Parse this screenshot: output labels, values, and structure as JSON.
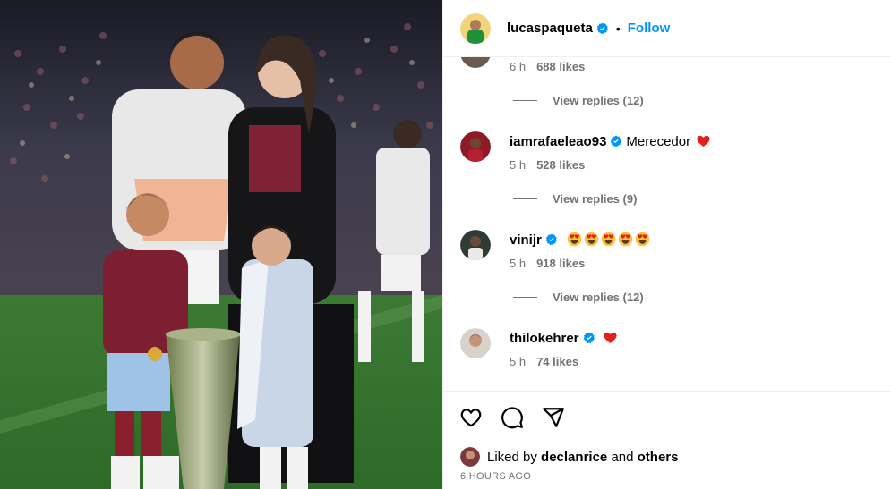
{
  "post": {
    "image_alt": "Footballer in white shirt with woman and two children beside a trophy on a stadium pitch",
    "author": {
      "username": "lucaspaqueta",
      "verified": true
    },
    "follow_label": "Follow",
    "separator": "•"
  },
  "comments": [
    {
      "username": "",
      "text": "",
      "time": "6 h",
      "likes": "688 likes",
      "replies_label": "View replies (12)",
      "partial": true
    },
    {
      "username": "iamrafaeleao93",
      "verified": true,
      "text": "Merecedor",
      "emoji": [
        "red-heart"
      ],
      "time": "5 h",
      "likes": "528 likes",
      "replies_label": "View replies (9)"
    },
    {
      "username": "vinijr",
      "verified": true,
      "text": "",
      "emoji": [
        "heart-eyes",
        "heart-eyes",
        "heart-eyes",
        "heart-eyes",
        "heart-eyes"
      ],
      "time": "5 h",
      "likes": "918 likes",
      "replies_label": "View replies (12)"
    },
    {
      "username": "thilokehrer",
      "verified": true,
      "text": "",
      "emoji": [
        "red-heart"
      ],
      "time": "5 h",
      "likes": "74 likes"
    }
  ],
  "actions": {
    "icons": [
      "heart-icon",
      "comment-icon",
      "share-icon"
    ]
  },
  "liked_by": {
    "prefix": "Liked by",
    "user": "declanrice",
    "conj": "and",
    "others": "others"
  },
  "posted_ago": "6 HOURS AGO",
  "colors": {
    "link": "#0095f6",
    "muted": "#737373",
    "divider": "#efefef",
    "heart": "#e0211c"
  }
}
